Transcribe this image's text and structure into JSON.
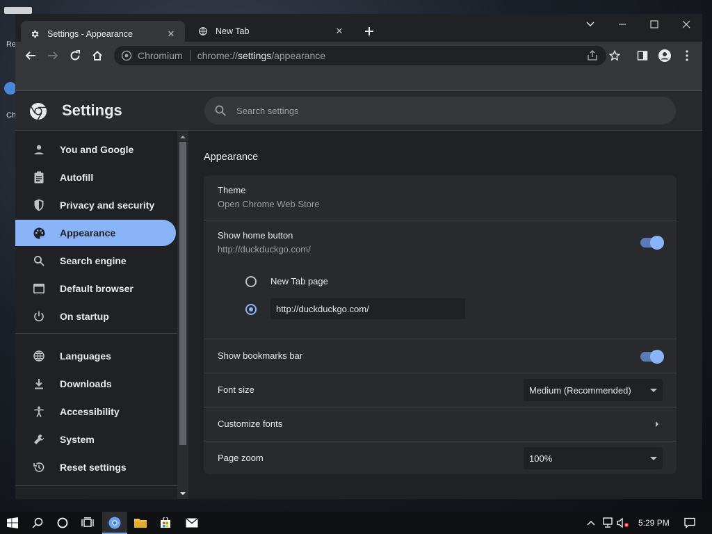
{
  "desktop": {
    "icon_label_1": "Re",
    "icon_label_2": "Ch"
  },
  "tabs": [
    {
      "title": "Settings - Appearance",
      "icon": "gear-icon",
      "active": true
    },
    {
      "title": "New Tab",
      "icon": "globe-icon",
      "active": false
    }
  ],
  "omnibox": {
    "chip": "Chromium",
    "url_prefix": "chrome://",
    "url_host": "settings",
    "url_path": "/appearance"
  },
  "settings": {
    "title": "Settings",
    "search_placeholder": "Search settings",
    "nav": [
      {
        "label": "You and Google",
        "icon": "person-icon"
      },
      {
        "label": "Autofill",
        "icon": "clipboard-icon"
      },
      {
        "label": "Privacy and security",
        "icon": "shield-icon"
      },
      {
        "label": "Appearance",
        "icon": "palette-icon",
        "active": true
      },
      {
        "label": "Search engine",
        "icon": "search-icon"
      },
      {
        "label": "Default browser",
        "icon": "browser-icon"
      },
      {
        "label": "On startup",
        "icon": "power-icon"
      },
      {
        "label": "Languages",
        "icon": "globe-icon"
      },
      {
        "label": "Downloads",
        "icon": "download-icon"
      },
      {
        "label": "Accessibility",
        "icon": "accessibility-icon"
      },
      {
        "label": "System",
        "icon": "wrench-icon"
      },
      {
        "label": "Reset settings",
        "icon": "history-icon"
      }
    ],
    "appearance": {
      "section_title": "Appearance",
      "theme_label": "Theme",
      "theme_sub": "Open Chrome Web Store",
      "home_button_label": "Show home button",
      "home_button_sub": "http://duckduckgo.com/",
      "home_button_on": true,
      "radio_newtab_label": "New Tab page",
      "radio_custom_value": "http://duckduckgo.com/",
      "selected_radio": "custom",
      "bookmarks_bar_label": "Show bookmarks bar",
      "bookmarks_bar_on": true,
      "font_size_label": "Font size",
      "font_size_value": "Medium (Recommended)",
      "customize_fonts_label": "Customize fonts",
      "page_zoom_label": "Page zoom",
      "page_zoom_value": "100%"
    }
  },
  "taskbar": {
    "time": "5:29 PM"
  },
  "colors": {
    "accent": "#8ab4f8",
    "surface": "#292a2d",
    "background": "#202124",
    "toolbar": "#35363a"
  }
}
